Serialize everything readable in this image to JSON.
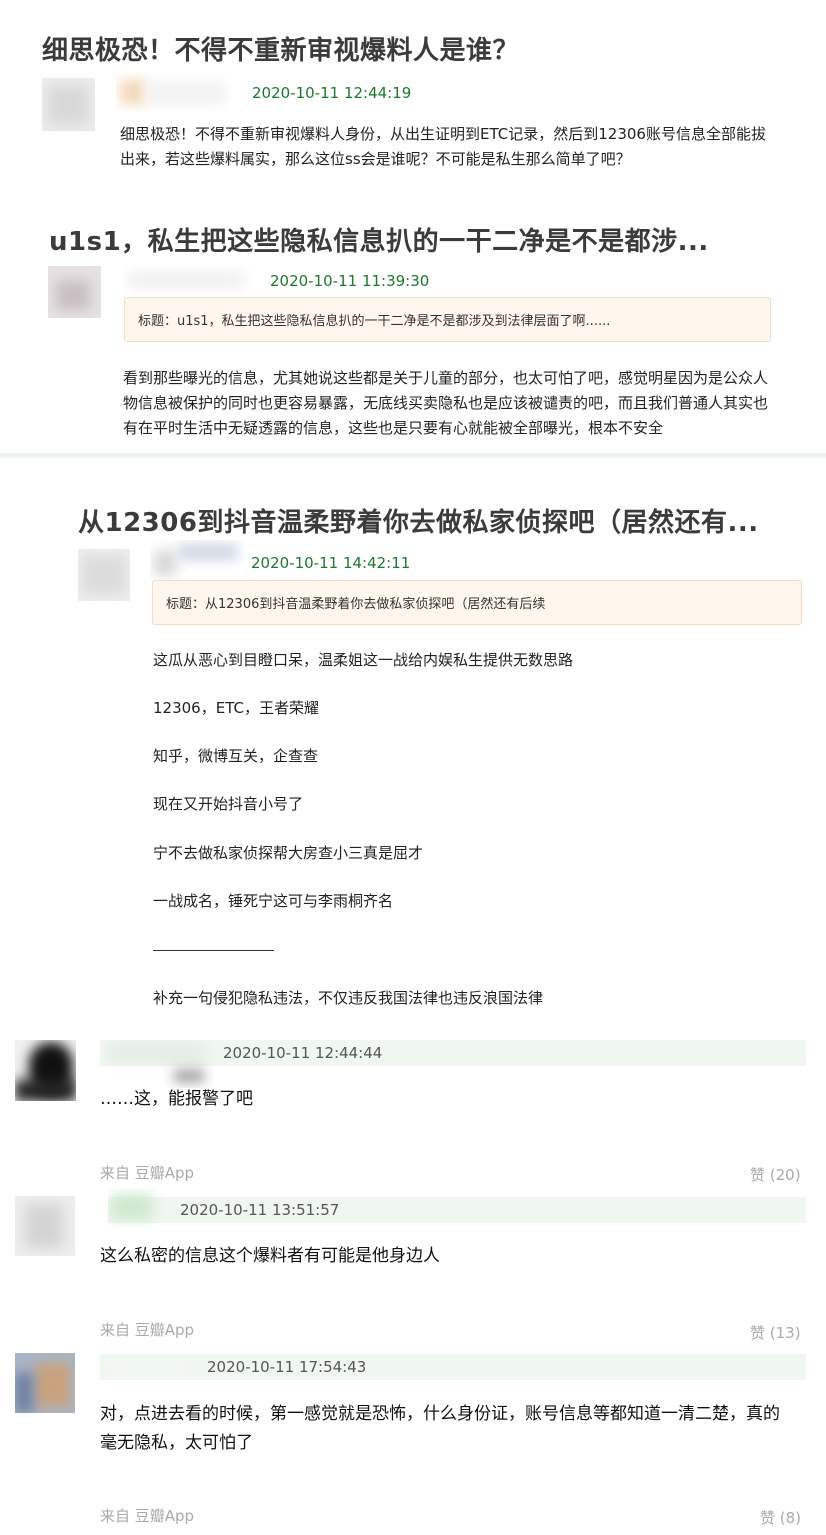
{
  "post1": {
    "title": "细思极恐！不得不重新审视爆料人是谁？",
    "date": "2020-10-11 12:44:19",
    "body_lines": [
      "细思极恐！不得不重新审视爆料人身份，从出生证明到ETC记录，然后到12306账号信息全部能拔",
      "出来，若这些爆料属实，那么这位ss会是谁呢？不可能是私生那么简单了吧？"
    ]
  },
  "post2": {
    "title": "u1s1，私生把这些隐私信息扒的一干二净是不是都涉...",
    "date": "2020-10-11 11:39:30",
    "quote": "标题：u1s1，私生把这些隐私信息扒的一干二净是不是都涉及到法律层面了啊......",
    "body_lines": [
      "看到那些曝光的信息，尤其她说这些都是关于儿童的部分，也太可怕了吧，感觉明星因为是公众人",
      "物信息被保护的同时也更容易暴露，无底线买卖隐私也是应该被谴责的吧，而且我们普通人其实也",
      "有在平时生活中无疑透露的信息，这些也是只要有心就能被全部曝光，根本不安全"
    ]
  },
  "post3": {
    "title": "从12306到抖音温柔野着你去做私家侦探吧（居然还有...",
    "date": "2020-10-11 14:42:11",
    "quote": "标题：从12306到抖音温柔野着你去做私家侦探吧（居然还有后续",
    "paragraphs": [
      "这瓜从恶心到目瞪口呆，温柔姐这一战给内娱私生提供无数思路",
      "12306，ETC，王者荣耀",
      "知乎，微博互关，企查查",
      "现在又开始抖音小号了",
      "宁不去做私家侦探帮大房查小三真是屈才",
      "一战成名，锤死宁这可与李雨桐齐名",
      "补充一句侵犯隐私违法，不仅违反我国法律也违反浪国法律"
    ]
  },
  "replies": [
    {
      "date": "2020-10-11 12:44:44",
      "text": "……这，能报警了吧",
      "source": "来自 豆瓣App",
      "likes": "赞 (20)"
    },
    {
      "date": "2020-10-11 13:51:57",
      "text": "这么私密的信息这个爆料者有可能是他身边人",
      "source": "来自 豆瓣App",
      "likes": "赞 (13)"
    },
    {
      "date": "2020-10-11 17:54:43",
      "text_lines": [
        "对，点进去看的时候，第一感觉就是恐怖，什么身份证，账号信息等都知道一清二楚，真的",
        "毫无隐私，太可怕了"
      ],
      "source": "来自 豆瓣App",
      "likes": "赞 (8)"
    }
  ],
  "colors": {
    "date_green": "#1b7a2a",
    "quote_bg": "#fff7ee",
    "reply_bar": "#f0f6f0"
  },
  "icons": [
    "avatar-blurred"
  ]
}
